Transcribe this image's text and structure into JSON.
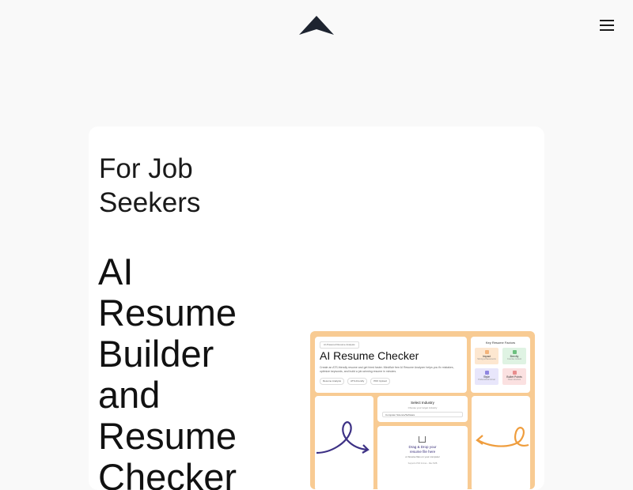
{
  "header": {
    "logo_icon": "arrowhead-logo-icon",
    "menu_icon": "hamburger-menu-icon"
  },
  "hero": {
    "eyebrow": "For Job Seekers",
    "headline": "AI\nResume\nBuilder\nand\nResume\nChecker"
  },
  "preview": {
    "badge": "AI-Powered Resume Analysis",
    "title": "AI Resume Checker",
    "description": "Create an ATS-friendly resume and get hired faster. Mindflair free AI Resume Analyzer helps you fix mistakes, optimize keywords, and build a job-winning resume in minutes.",
    "chips": [
      "Resume Analysis",
      "ATS-Friendly",
      "PDF Upload"
    ],
    "factors_title": "Key Resume Factors",
    "factors": [
      {
        "title": "Impact",
        "sub": "Strong achievements",
        "color": "#fde7d0",
        "dot": "#f3b37a"
      },
      {
        "title": "Brevity",
        "sub": "Concise content",
        "color": "#dff3e3",
        "dot": "#6cc07e"
      },
      {
        "title": "Style",
        "sub": "Professional format",
        "color": "#e8e6fb",
        "dot": "#8f86e0"
      },
      {
        "title": "Bullet Points",
        "sub": "Clear structure",
        "color": "#fbe1e1",
        "dot": "#e88d8d"
      }
    ],
    "industry_title": "Select Industry",
    "industry_sub": "Choose your target industry",
    "industry_value": "Computer Science/Software",
    "upload_text": "Drag & Drop your\nresume file here",
    "upload_sub": "or browse files on your computer",
    "upload_note": "Supports PDF format – Max 5MB",
    "colors": {
      "frame": "#f8cb93",
      "swirl_left": "#3d3185",
      "swirl_right": "#ef9d3d"
    }
  }
}
